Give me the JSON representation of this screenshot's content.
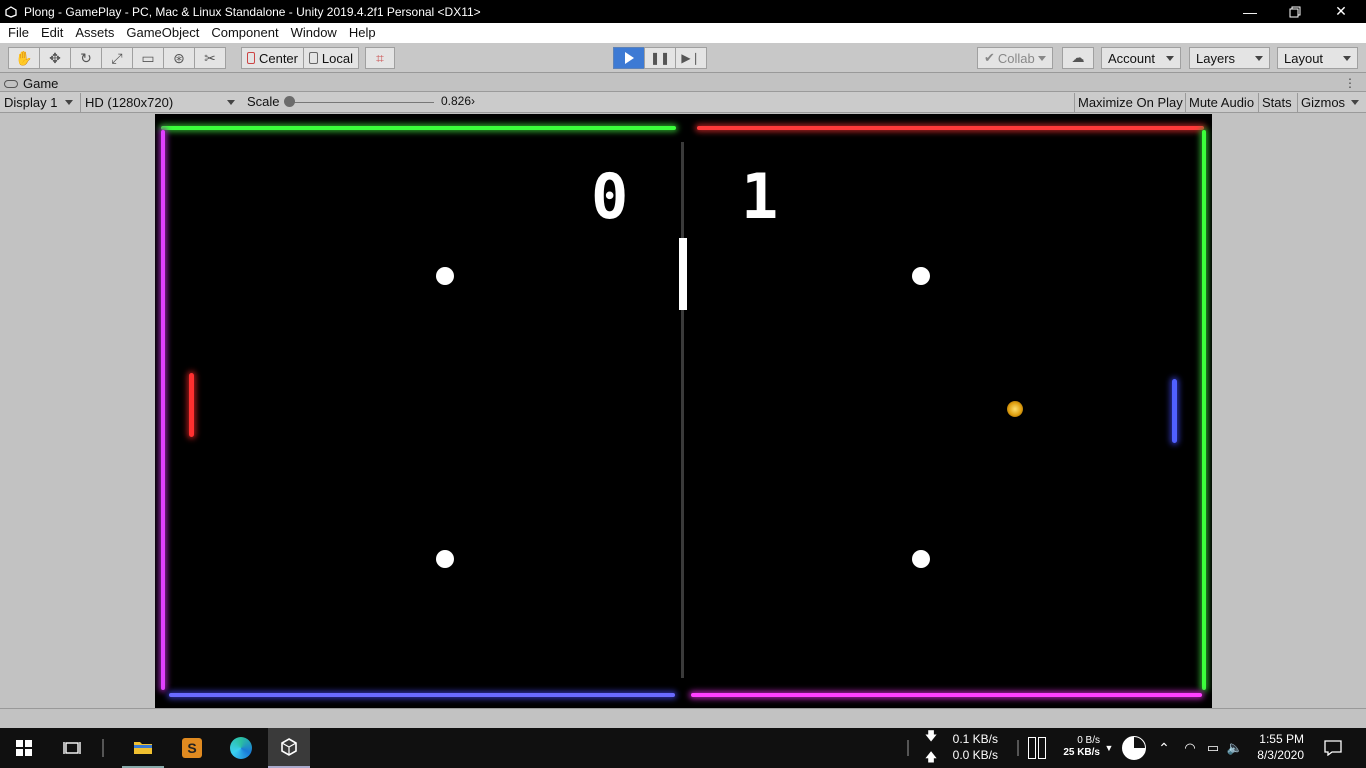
{
  "window": {
    "title": "Plong - GamePlay - PC, Mac & Linux Standalone - Unity 2019.4.2f1 Personal <DX11>",
    "minimize_icon": "minimize-icon",
    "maximize_icon": "restore-icon",
    "close_icon": "close-icon"
  },
  "menu": [
    "File",
    "Edit",
    "Assets",
    "GameObject",
    "Component",
    "Window",
    "Help"
  ],
  "toolbar": {
    "tools": [
      "hand-icon",
      "move-icon",
      "rotate-icon",
      "scale-icon",
      "rect-icon",
      "transform-icon",
      "custom-tool-icon"
    ],
    "pivot_mode": "Center",
    "pivot_rotation": "Local",
    "collab": "Collab",
    "account": "Account",
    "layers": "Layers",
    "layout": "Layout"
  },
  "game_tab": {
    "label": "Game"
  },
  "game_toolbar": {
    "display": "Display 1",
    "resolution": "HD (1280x720)",
    "scale_label": "Scale",
    "scale_value": "0.826",
    "scale_value_display": "0.826›",
    "maximize_on_play": "Maximize On Play",
    "mute_audio": "Mute Audio",
    "stats": "Stats",
    "gizmos": "Gizmos"
  },
  "game": {
    "score_left": "0",
    "score_right": "1",
    "colors": {
      "top_left_border": "#3bff3b",
      "top_right_border": "#ff2e2e",
      "left_border": "#e040ff",
      "right_border": "#3bff3b",
      "bottom_left_border": "#6060ff",
      "bottom_right_border": "#ff40ff",
      "left_paddle": "#ff3030",
      "right_paddle": "#5060ff",
      "ball": "#f0b020"
    }
  },
  "taskbar": {
    "net_down": "0.1 KB/s",
    "net_up": "0.0 KB/s",
    "disk_top": "0 B/s",
    "disk_bottom": "25 KB/s",
    "time": "1:55 PM",
    "date": "8/3/2020"
  }
}
